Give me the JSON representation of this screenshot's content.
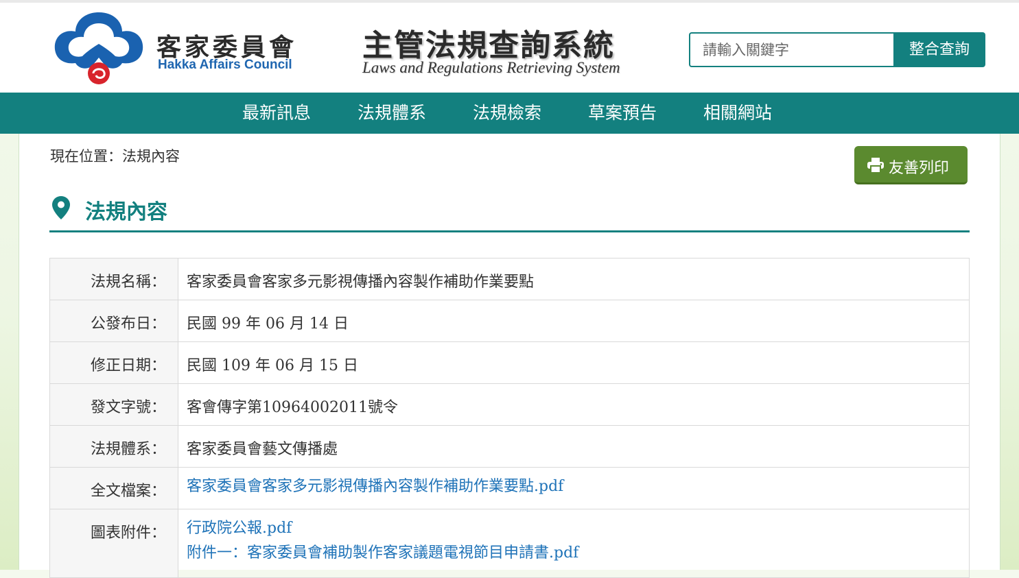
{
  "header": {
    "logo_cn": "客家委員會",
    "logo_en": "Hakka Affairs Council",
    "system_title_cn": "主管法規查詢系統",
    "system_title_en": "Laws and Regulations Retrieving System",
    "search_placeholder": "請輸入關鍵字",
    "search_button": "整合查詢"
  },
  "nav": {
    "items": [
      "最新訊息",
      "法規體系",
      "法規檢索",
      "草案預告",
      "相關網站"
    ]
  },
  "breadcrumb": "現在位置：法規內容",
  "print_button": "友善列印",
  "page_title": "法規內容",
  "colors": {
    "primary": "#13807f",
    "print_button": "#5b8a2f",
    "link": "#1f73b8"
  },
  "rows": [
    {
      "label": "法規名稱：",
      "value": "客家委員會客家多元影視傳播內容製作補助作業要點"
    },
    {
      "label": "公發布日：",
      "value": "民國 99 年 06 月 14 日"
    },
    {
      "label": "修正日期：",
      "value": "民國 109 年 06 月 15 日"
    },
    {
      "label": "發文字號：",
      "value": "客會傳字第10964002011號令"
    },
    {
      "label": "法規體系：",
      "value": "客家委員會藝文傳播處"
    },
    {
      "label": "全文檔案：",
      "links": [
        "客家委員會客家多元影視傳播內容製作補助作業要點.pdf"
      ]
    },
    {
      "label": "圖表附件：",
      "links": [
        "行政院公報.pdf",
        "附件一：客家委員會補助製作客家議題電視節目申請書.pdf"
      ]
    }
  ]
}
